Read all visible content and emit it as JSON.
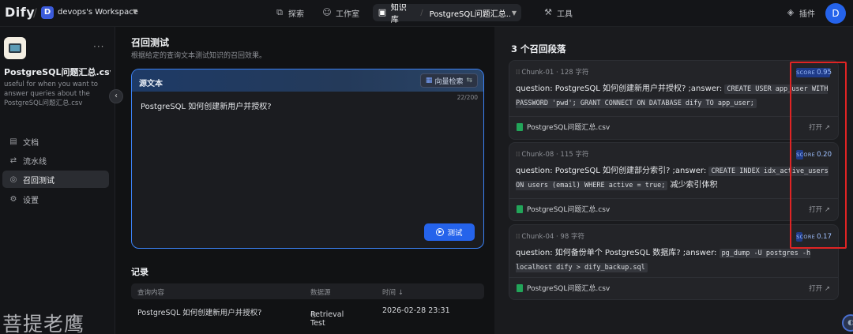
{
  "topbar": {
    "logo": "Dify",
    "workspace_initial": "D",
    "workspace_name": "devops's Workspace",
    "nav": {
      "explore": "探索",
      "studio": "工作室",
      "knowledge": "知识库",
      "current_kb": "PostgreSQL问题汇总....",
      "tools": "工具",
      "plugins": "插件"
    },
    "avatar_initial": "D"
  },
  "sidebar": {
    "kb_title": "PostgreSQL问题汇总.csv...",
    "kb_desc": "useful for when you want to answer queries about the PostgreSQL问题汇总.csv",
    "items": [
      {
        "label": "文档",
        "icon": "document-icon"
      },
      {
        "label": "流水线",
        "icon": "pipeline-icon"
      },
      {
        "label": "召回测试",
        "icon": "target-icon"
      },
      {
        "label": "设置",
        "icon": "settings-icon"
      }
    ]
  },
  "main": {
    "title": "召回测试",
    "subtitle": "根据给定的查询文本测试知识的召回效果。",
    "query": {
      "label": "源文本",
      "mode": "向量检索",
      "count": "22/200",
      "text": "PostgreSQL 如何创建新用户并授权?",
      "button": "测试"
    },
    "records": {
      "title": "记录",
      "headers": [
        "查询内容",
        "数据源",
        "时间 ↓"
      ],
      "rows": [
        {
          "query": "PostgreSQL 如何创建新用户并授权?",
          "source": "Retrieval Test",
          "time": "2026-02-28 23:31"
        }
      ]
    }
  },
  "results": {
    "title": "3 个召回段落",
    "score_label": "SCORE",
    "open_label": "打开 ↗",
    "chunks": [
      {
        "id": "Chunk-01",
        "chars": "128 字符",
        "score": "0.95",
        "score_value": 0.95,
        "text_prefix": "question: PostgreSQL 如何创建新用户并授权? ;answer: ",
        "code": "CREATE USER app_user WITH PASSWORD 'pwd'; GRANT CONNECT ON DATABASE dify TO app_user;",
        "text_suffix": "",
        "file": "PostgreSQL问题汇总.csv"
      },
      {
        "id": "Chunk-08",
        "chars": "115 字符",
        "score": "0.20",
        "score_value": 0.2,
        "text_prefix": "question: PostgreSQL 如何创建部分索引? ;answer: ",
        "code": "CREATE INDEX idx_active_users ON users (email) WHERE active = true;",
        "text_suffix": " 减少索引体积",
        "file": "PostgreSQL问题汇总.csv"
      },
      {
        "id": "Chunk-04",
        "chars": "98 字符",
        "score": "0.17",
        "score_value": 0.17,
        "text_prefix": "question: 如何备份单个 PostgreSQL 数据库? ;answer: ",
        "code": "pg_dump -U postgres -h localhost dify > dify_backup.sql",
        "text_suffix": "",
        "file": "PostgreSQL问题汇总.csv"
      }
    ]
  },
  "watermark": "菩提老鹰",
  "colors": {
    "accent": "#2563eb",
    "highlight": "#e02424"
  }
}
